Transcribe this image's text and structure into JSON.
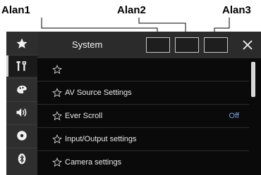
{
  "callouts": [
    {
      "label": "Alan1"
    },
    {
      "label": "Alan2"
    },
    {
      "label": "Alan3"
    }
  ],
  "header": {
    "title": "System",
    "close_icon": "close-icon"
  },
  "sidebar": {
    "items": [
      {
        "icon": "star-icon",
        "active": false
      },
      {
        "icon": "settings-tools-icon",
        "active": true
      },
      {
        "icon": "theme-icon",
        "active": false
      },
      {
        "icon": "audio-icon",
        "active": false
      },
      {
        "icon": "disc-icon",
        "active": false
      },
      {
        "icon": "bluetooth-icon",
        "active": false
      }
    ]
  },
  "list": {
    "items": [
      {
        "label": "",
        "value": ""
      },
      {
        "label": "AV Source Settings",
        "value": ""
      },
      {
        "label": "Ever Scroll",
        "value": "Off"
      },
      {
        "label": "Input/Output settings",
        "value": ""
      },
      {
        "label": "Camera settings",
        "value": ""
      }
    ]
  },
  "colors": {
    "screen_bg": "#0a0a0a",
    "sidebar_bg": "#2e2e2e",
    "header_bg": "#2b2b2b",
    "value_blue": "#7ea6e6"
  }
}
